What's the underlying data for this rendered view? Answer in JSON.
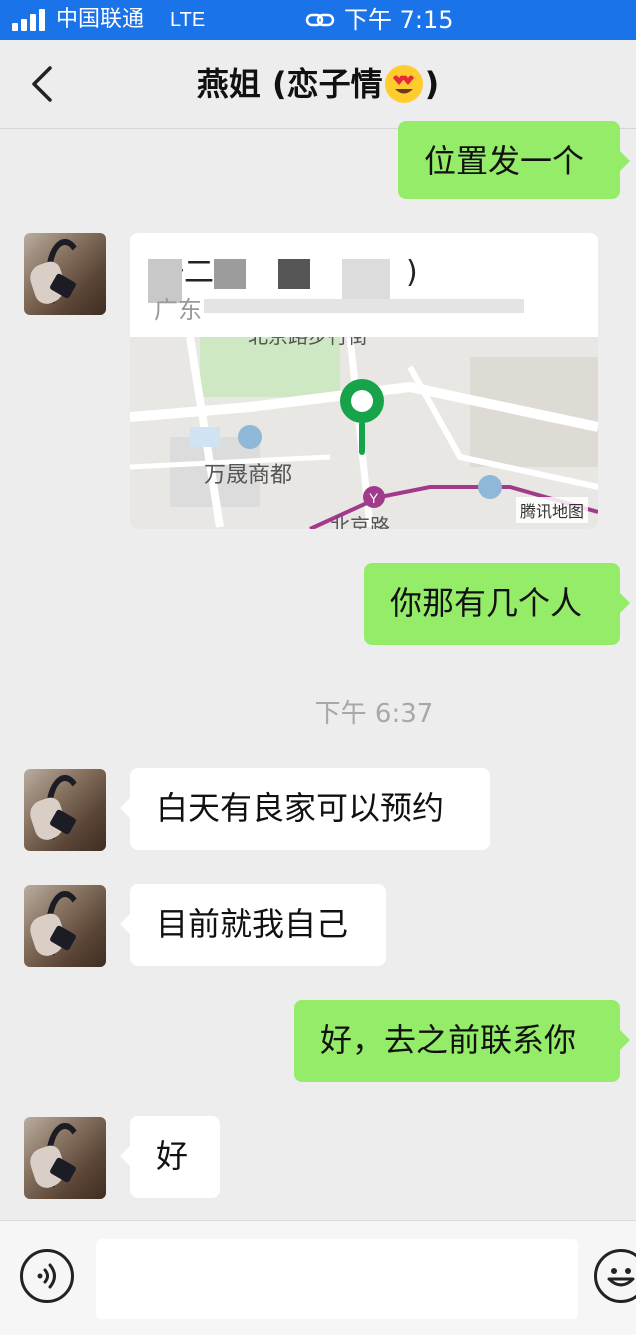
{
  "status_bar": {
    "carrier": "中国联通",
    "network": "LTE",
    "time": "下午 7:15"
  },
  "nav": {
    "title": "燕姐 (恋子情",
    "title_end": ")",
    "title_emoji": "heart-eyes-emoji"
  },
  "messages": {
    "m1": {
      "text": "位置发一个",
      "direction": "outgoing"
    },
    "location": {
      "direction": "incoming",
      "name_visible": "一二",
      "name_suffix": ")",
      "address_prefix": "广东",
      "map_labels": {
        "mall": "万晟商都",
        "road": "北京路",
        "street_top": "北京路步行街"
      },
      "map_credit": "腾讯地图"
    },
    "m2": {
      "text": "你那有几个人",
      "direction": "outgoing"
    },
    "timestamp": "下午 6:37",
    "m3": {
      "text": "白天有良家可以预约",
      "direction": "incoming"
    },
    "m4": {
      "text": "目前就我自己",
      "direction": "incoming"
    },
    "m5": {
      "text": "好，去之前联系你",
      "direction": "outgoing"
    },
    "m6": {
      "text": "好",
      "direction": "incoming"
    }
  },
  "input_bar": {
    "icons": [
      "voice-icon",
      "emoji-icon"
    ]
  },
  "colors": {
    "status_bar": "#1a73e8",
    "background": "#ededed",
    "outgoing_bubble": "#95ec69",
    "incoming_bubble": "#ffffff",
    "map_pin": "#16a34a"
  }
}
